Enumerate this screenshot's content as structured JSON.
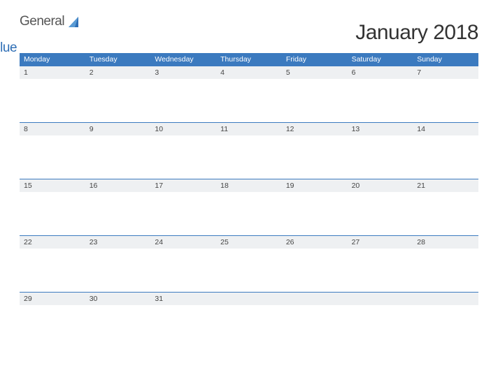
{
  "brand": {
    "word1": "General",
    "word2": "Blue"
  },
  "title": "January 2018",
  "days": [
    "Monday",
    "Tuesday",
    "Wednesday",
    "Thursday",
    "Friday",
    "Saturday",
    "Sunday"
  ],
  "weeks": [
    [
      "1",
      "2",
      "3",
      "4",
      "5",
      "6",
      "7"
    ],
    [
      "8",
      "9",
      "10",
      "11",
      "12",
      "13",
      "14"
    ],
    [
      "15",
      "16",
      "17",
      "18",
      "19",
      "20",
      "21"
    ],
    [
      "22",
      "23",
      "24",
      "25",
      "26",
      "27",
      "28"
    ],
    [
      "29",
      "30",
      "31",
      "",
      "",
      "",
      ""
    ]
  ],
  "colors": {
    "accent": "#3b7abf",
    "stripe": "#eef0f2"
  }
}
